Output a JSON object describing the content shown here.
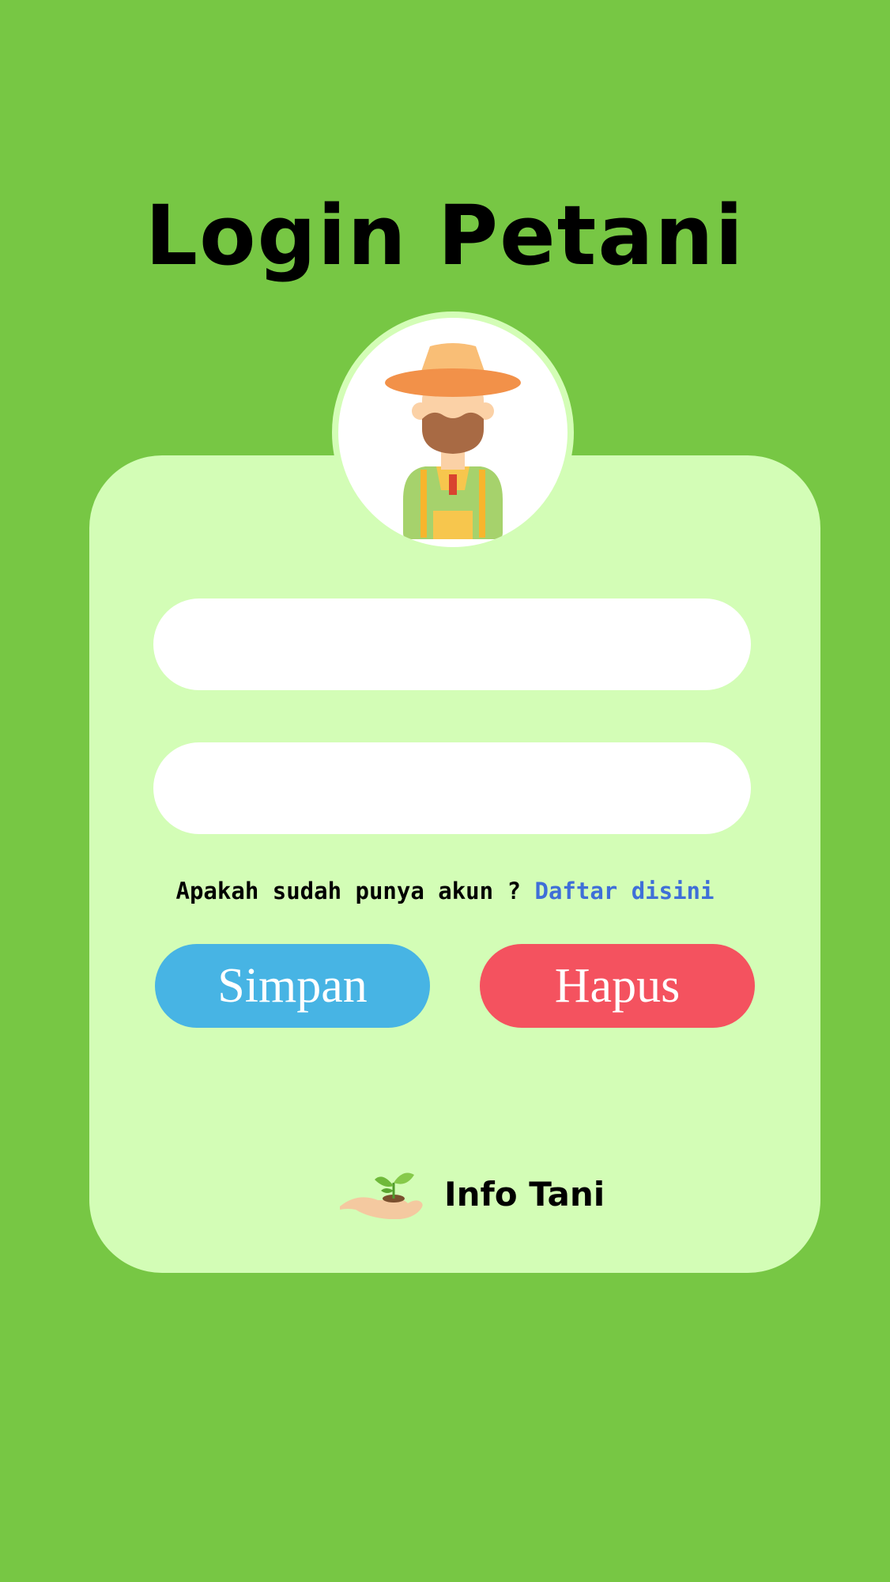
{
  "header": {
    "title": "Login Petani"
  },
  "avatar": {
    "icon": "farmer-icon"
  },
  "form": {
    "username": {
      "value": "",
      "placeholder": ""
    },
    "password": {
      "value": "",
      "placeholder": ""
    },
    "account_prompt": "Apakah sudah punya akun ?",
    "register_link": "Daftar disini",
    "save_label": "Simpan",
    "delete_label": "Hapus"
  },
  "footer": {
    "brand_icon": "plant-in-hand-icon",
    "brand_name": "Info Tani"
  },
  "colors": {
    "background": "#77c744",
    "card": "#d3fdb6",
    "link": "#3f6fd8",
    "save_button": "#47b4e4",
    "delete_button": "#f4525f"
  }
}
